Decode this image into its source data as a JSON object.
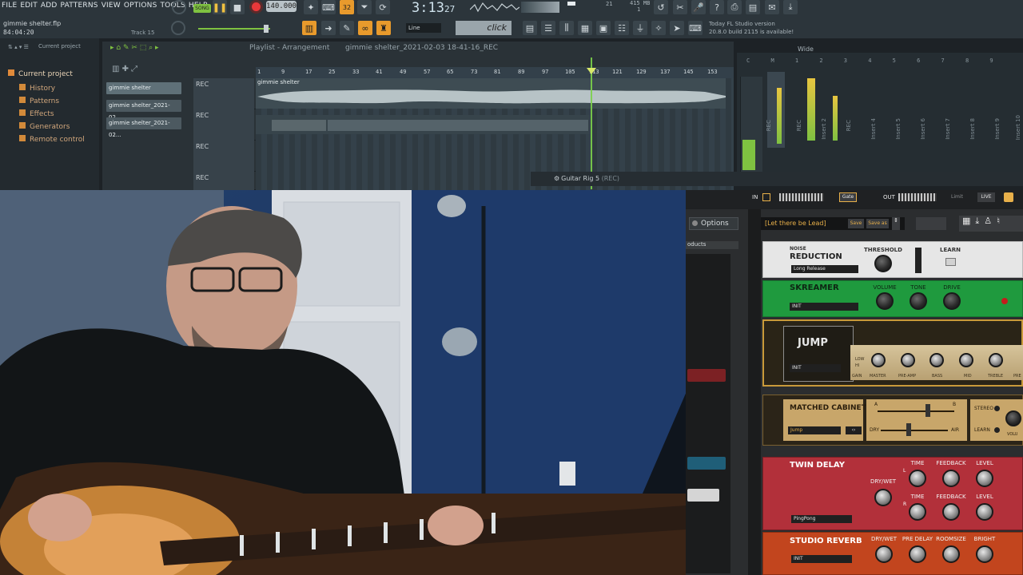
{
  "menu": [
    "FILE",
    "EDIT",
    "ADD",
    "PATTERNS",
    "VIEW",
    "OPTIONS",
    "TOOLS",
    "HELP"
  ],
  "toolbar": {
    "mode": "SONG",
    "tempo": "140.000",
    "time": "3:13",
    "time_sub": "27",
    "snap": "Line",
    "metronome_sound": "click",
    "memory": "415 MB",
    "cpu": "21",
    "voices": "1"
  },
  "project": {
    "file": "gimmie shelter.flp",
    "time": "84:04:20",
    "track": "Track 15"
  },
  "news": {
    "line1": "Today  FL Studio version",
    "line2": "20.8.0 build 2115 is available!"
  },
  "browser": {
    "header": "Current project",
    "items": [
      "Current project",
      "History",
      "Patterns",
      "Effects",
      "Generators",
      "Remote control"
    ]
  },
  "playlist": {
    "title": "Playlist - Arrangement",
    "pattern": "gimmie shelter_2021-02-03 18-41-16_REC",
    "picker": [
      "gimmie shelter",
      "gimmie shelter_2021-02...",
      "gimmie shelter_2021-02..."
    ],
    "ruler": [
      "1",
      "9",
      "17",
      "25",
      "33",
      "41",
      "49",
      "57",
      "65",
      "73",
      "81",
      "89",
      "97",
      "105",
      "113",
      "121",
      "129",
      "137",
      "145",
      "153"
    ],
    "tracks": [
      "REC",
      "REC",
      "REC",
      "REC"
    ],
    "clip_label": "gimmie shelter"
  },
  "mixer": {
    "wide_label": "Wide",
    "top_numbers": [
      "C",
      "M",
      "1",
      "2",
      "3",
      "4",
      "5",
      "6",
      "7",
      "8",
      "9"
    ],
    "strips": [
      "REC",
      "REC",
      "Insert 2",
      "REC",
      "Insert 4",
      "Insert 5",
      "Insert 6",
      "Insert 7",
      "Insert 8",
      "Insert 9",
      "Insert 10"
    ]
  },
  "guitar_rig_window": {
    "title": "Guitar Rig 5",
    "suffix": "(REC)"
  },
  "rig": {
    "in_label": "IN",
    "out_label": "OUT",
    "gate_label": "Gate",
    "limit_label": "Limit",
    "live_label": "LIVE",
    "options": "Options",
    "products": "oducts",
    "preset": "[Let there be Lead]",
    "save": "Save",
    "save_as": "Save as",
    "modules": {
      "noise": {
        "title1": "NOISE",
        "title2": "REDUCTION",
        "mode": "Long Release",
        "threshold": "THRESHOLD",
        "learn": "LEARN"
      },
      "skreamer": {
        "title": "SKREAMER",
        "preset": "INIT",
        "knobs": [
          "VOLUME",
          "TONE",
          "DRIVE"
        ]
      },
      "jump": {
        "title": "JUMP",
        "preset": "INIT",
        "labels": [
          "LOW",
          "HI",
          "GAIN",
          "MASTER",
          "PRE-AMP",
          "BASS",
          "MID",
          "TREBLE",
          "PRE"
        ]
      },
      "cabinet": {
        "title": "MATCHED CABINET",
        "preset": "Jump",
        "labels": [
          "A",
          "B",
          "DRY",
          "AIR",
          "STEREO",
          "LEARN",
          "VOLU"
        ]
      },
      "delay": {
        "title": "TWIN DELAY",
        "preset": "PingPong",
        "dry_wet": "DRY/WET",
        "time": "TIME",
        "feedback": "FEEDBACK",
        "level": "LEVEL",
        "l": "L",
        "r": "R"
      },
      "reverb": {
        "title": "STUDIO REVERB",
        "preset": "INIT",
        "labels": [
          "DRY/WET",
          "PRE DELAY",
          "ROOMSIZE",
          "BRIGHT"
        ]
      }
    }
  }
}
